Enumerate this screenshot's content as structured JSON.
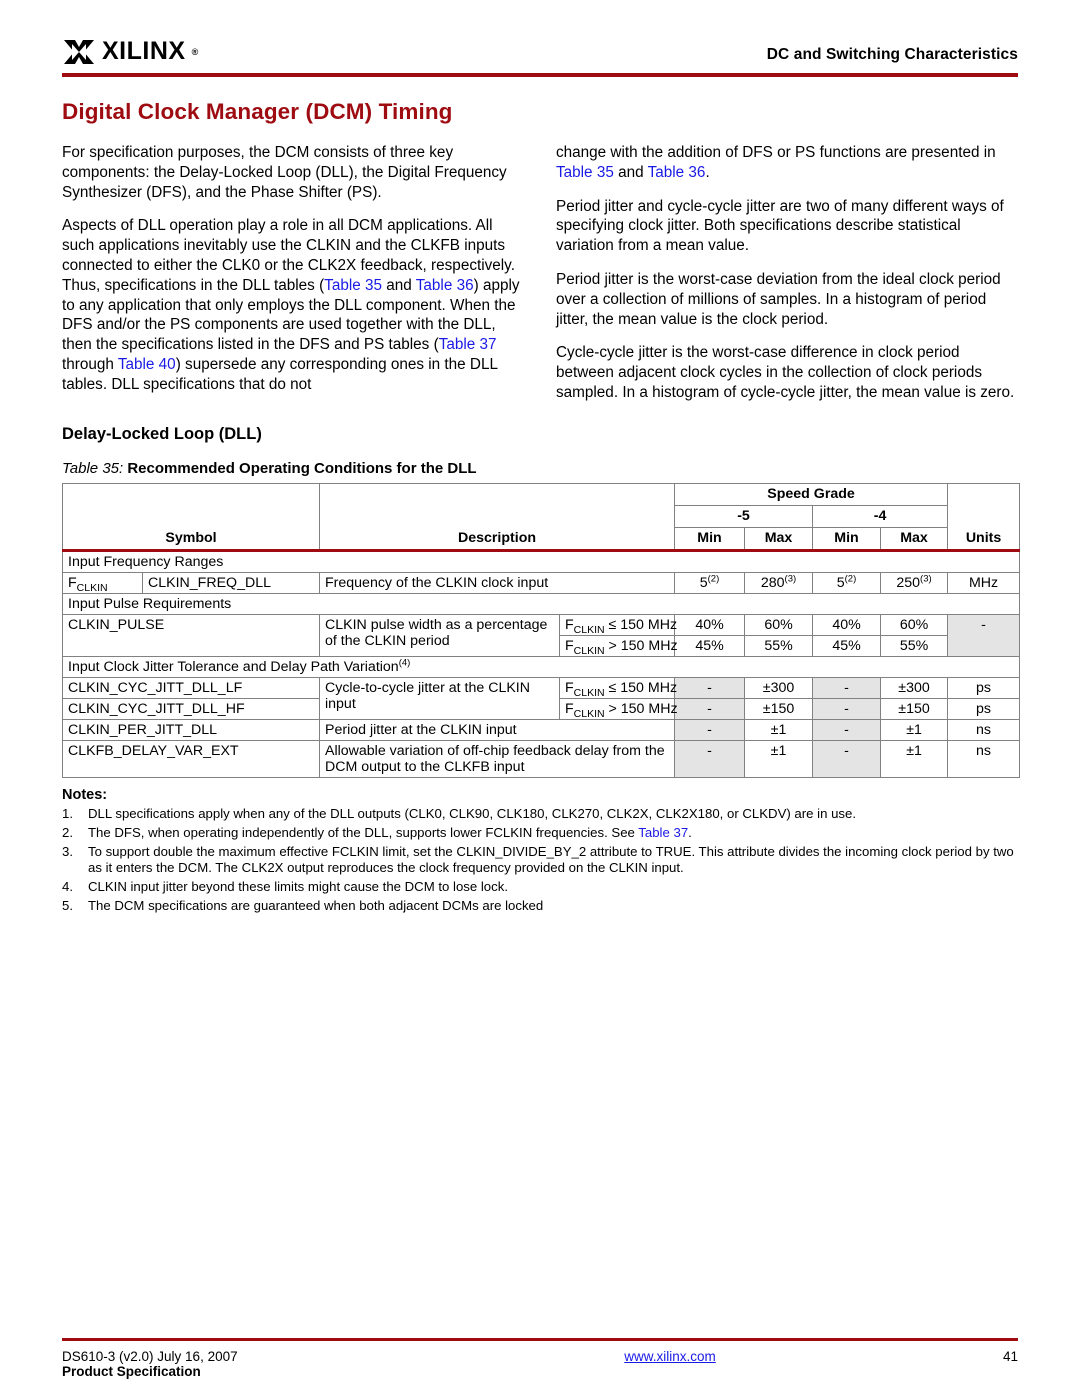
{
  "header": {
    "logo_text": "XILINX",
    "logo_mark": "xilinx-x-logo",
    "registered_mark": "®",
    "running_head": "DC and Switching Characteristics",
    "rule_color": "#9E0B10"
  },
  "title": "Digital Clock Manager (DCM) Timing",
  "body": {
    "left": [
      "For specification purposes, the DCM consists of three key components: the Delay-Locked Loop (DLL), the Digital Frequency Synthesizer (DFS), and the Phase Shifter (PS).",
      "Aspects of DLL operation play a role in all DCM applications. All such applications inevitably use the CLKIN and the CLKFB inputs connected to either the CLK0 or the CLK2X feedback, respectively. Thus, specifications in the DLL tables (Table 35 and Table 36) apply to any application that only employs the DLL component. When the DFS and/or the PS components are used together with the DLL, then the specifications listed in the DFS and PS tables (Table 37 through Table 40) supersede any corresponding ones in the DLL tables. DLL specifications that do not"
    ],
    "right": [
      "change with the addition of DFS or PS functions are presented in Table 35 and Table 36.",
      "Period jitter and cycle-cycle jitter are two of many different ways of specifying clock jitter. Both specifications describe statistical variation from a mean value.",
      "Period jitter is the worst-case deviation from the ideal clock period over a collection of millions of samples. In a histogram of period jitter, the mean value is the clock period.",
      "Cycle-cycle jitter is the worst-case difference in clock period between adjacent clock cycles in the collection of clock periods sampled. In a histogram of cycle-cycle jitter, the mean value is zero."
    ],
    "xref_color": "#1A1AE6"
  },
  "subsection_heading": "Delay-Locked Loop (DLL)",
  "table": {
    "caption_label": "Table  35:",
    "caption_text": "Recommended Operating Conditions for the DLL",
    "header": {
      "symbol": "Symbol",
      "description": "Description",
      "speed_grade": "Speed Grade",
      "grade_5": "-5",
      "grade_4": "-4",
      "min": "Min",
      "max": "Max",
      "units": "Units"
    },
    "sections": [
      {
        "title": "Input Frequency Ranges",
        "rows": [
          {
            "symbol_sub": "F",
            "symbol_sub_script": "CLKIN",
            "symbol_name": "CLKIN_FREQ_DLL",
            "description": "Frequency of the CLKIN clock input",
            "condition": "",
            "min5": "5",
            "min5_sup": "(2)",
            "max5": "280",
            "max5_sup": "(3)",
            "min4": "5",
            "min4_sup": "(2)",
            "max4": "250",
            "max4_sup": "(3)",
            "units": "MHz"
          }
        ]
      },
      {
        "title": "Input Pulse Requirements",
        "rows": [
          {
            "symbol_name": "CLKIN_PULSE",
            "description": "CLKIN pulse width as a percentage of the CLKIN period",
            "condition": "F",
            "condition_sub": "CLKIN",
            "condition_tail": " ≤ 150 MHz",
            "min5": "40%",
            "max5": "60%",
            "min4": "40%",
            "max4": "60%",
            "units": "-"
          },
          {
            "symbol_name": "",
            "description": "",
            "condition": "F",
            "condition_sub": "CLKIN",
            "condition_tail": " > 150 MHz",
            "min5": "45%",
            "max5": "55%",
            "min4": "45%",
            "max4": "55%",
            "units": "-"
          }
        ]
      },
      {
        "title": "Input Clock Jitter Tolerance and Delay Path Variation",
        "title_sup": "(4)",
        "rows": [
          {
            "symbol_name": "CLKIN_CYC_JITT_DLL_LF",
            "description": "Cycle-to-cycle jitter at the CLKIN input",
            "condition": "F",
            "condition_sub": "CLKIN",
            "condition_tail": " ≤ 150 MHz",
            "min5": "-",
            "max5": "±300",
            "min4": "-",
            "max4": "±300",
            "units": "ps"
          },
          {
            "symbol_name": "CLKIN_CYC_JITT_DLL_HF",
            "description": "",
            "condition": "F",
            "condition_sub": "CLKIN",
            "condition_tail": " > 150 MHz",
            "min5": "-",
            "max5": "±150",
            "min4": "-",
            "max4": "±150",
            "units": "ps"
          },
          {
            "symbol_name": "CLKIN_PER_JITT_DLL",
            "description": "Period jitter at the CLKIN input",
            "condition": "",
            "min5": "-",
            "max5": "±1",
            "min4": "-",
            "max4": "±1",
            "units": "ns"
          },
          {
            "symbol_name": "CLKFB_DELAY_VAR_EXT",
            "description": "Allowable variation of off-chip feedback delay from the DCM output to the CLKFB input",
            "condition": "",
            "min5": "-",
            "max5": "±1",
            "min4": "-",
            "max4": "±1",
            "units": "ns"
          }
        ]
      }
    ]
  },
  "notes": {
    "title": "Notes:",
    "items": [
      {
        "num": "1.",
        "text": "DLL specifications apply when any of the DLL outputs (CLK0, CLK90, CLK180, CLK270, CLK2X, CLK2X180, or CLKDV) are in use."
      },
      {
        "num": "2.",
        "text": "The DFS, when operating independently of the DLL, supports lower FCLKIN frequencies. See Table 37.",
        "link": "Table 37"
      },
      {
        "num": "3.",
        "text": "To support double the maximum effective FCLKIN limit, set the CLKIN_DIVIDE_BY_2 attribute to TRUE. This attribute divides the incoming clock period by two as it enters the DCM. The CLK2X output reproduces the clock frequency provided on the CLKIN input."
      },
      {
        "num": "4.",
        "text": "CLKIN input jitter beyond these limits might cause the DCM to lose lock."
      },
      {
        "num": "5.",
        "text": "The DCM specifications are guaranteed when both adjacent DCMs are locked"
      }
    ]
  },
  "footer": {
    "doc_id": "DS610-3 (v2.0) July 16, 2007",
    "doc_type": "Product Specification",
    "url": "www.xilinx.com",
    "page_number": "41"
  }
}
